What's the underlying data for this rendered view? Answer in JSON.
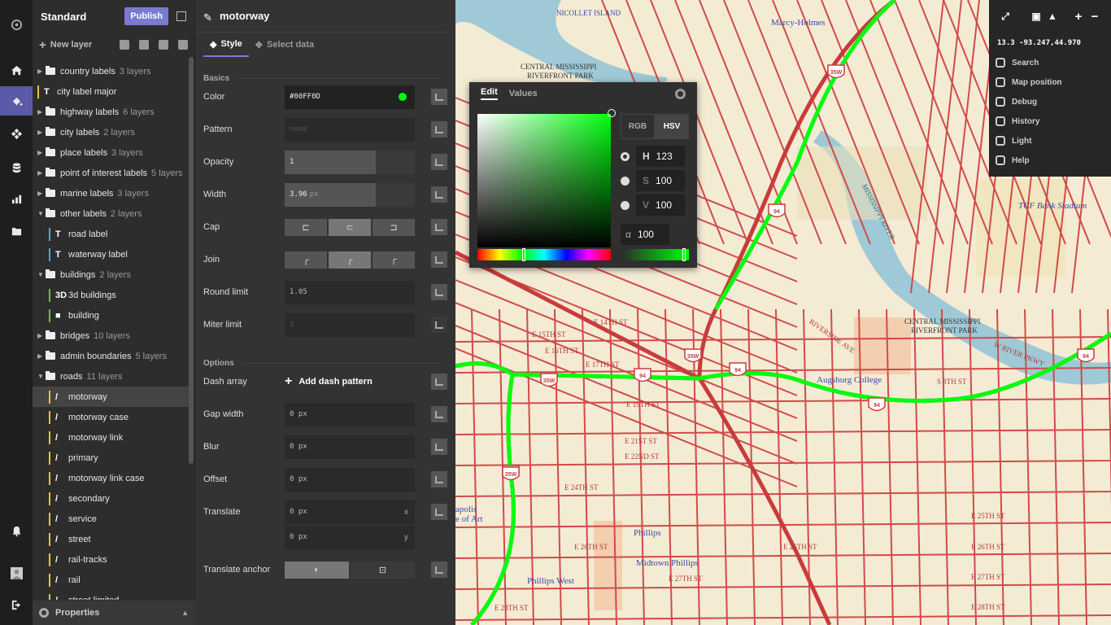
{
  "colors": {
    "accent": "#7a7ad0",
    "selected_color": "#00FF0D",
    "road_red": "#d24a4a",
    "map_bg": "#f4ebd4"
  },
  "rail": [
    {
      "icon": "logo-icon"
    },
    {
      "icon": "home-icon"
    },
    {
      "icon": "paint-bucket-icon"
    },
    {
      "icon": "components-icon"
    },
    {
      "icon": "database-icon"
    },
    {
      "icon": "chart-icon"
    },
    {
      "icon": "file-icon"
    },
    {
      "icon": "bell-icon"
    },
    {
      "icon": "user-icon"
    },
    {
      "icon": "logout-icon"
    }
  ],
  "layers_panel": {
    "title": "Standard",
    "publish": "Publish",
    "new_layer": "New layer",
    "properties": "Properties",
    "items": [
      {
        "kind": "group",
        "name": "country labels",
        "count": "3 layers",
        "open": false
      },
      {
        "kind": "layer",
        "type": "T",
        "name": "city label major",
        "bar": "#e8c23a",
        "child": false
      },
      {
        "kind": "group",
        "name": "highway labels",
        "count": "6 layers",
        "open": false
      },
      {
        "kind": "group",
        "name": "city labels",
        "count": "2 layers",
        "open": false
      },
      {
        "kind": "group",
        "name": "place labels",
        "count": "3 layers",
        "open": false
      },
      {
        "kind": "group",
        "name": "point of interest labels",
        "count": "5 layers",
        "open": false
      },
      {
        "kind": "group",
        "name": "marine labels",
        "count": "3 layers",
        "open": false
      },
      {
        "kind": "group",
        "name": "other labels",
        "count": "2 layers",
        "open": true
      },
      {
        "kind": "layer",
        "type": "T",
        "name": "road label",
        "bar": "#4aa8d8",
        "child": true
      },
      {
        "kind": "layer",
        "type": "T",
        "name": "waterway label",
        "bar": "#4aa8d8",
        "child": true
      },
      {
        "kind": "group",
        "name": "buildings",
        "count": "2 layers",
        "open": true
      },
      {
        "kind": "layer",
        "type": "3D",
        "name": "3d buildings",
        "bar": "#6ac04a",
        "child": true
      },
      {
        "kind": "layer",
        "type": "■",
        "name": "building",
        "bar": "#6ac04a",
        "child": true
      },
      {
        "kind": "group",
        "name": "bridges",
        "count": "10 layers",
        "open": false
      },
      {
        "kind": "group",
        "name": "admin boundaries",
        "count": "5 layers",
        "open": false
      },
      {
        "kind": "group",
        "name": "roads",
        "count": "11 layers",
        "open": true
      },
      {
        "kind": "layer",
        "type": "/",
        "name": "motorway",
        "bar": "#e8c23a",
        "child": true,
        "selected": true
      },
      {
        "kind": "layer",
        "type": "/",
        "name": "motorway case",
        "bar": "#e8c23a",
        "child": true
      },
      {
        "kind": "layer",
        "type": "/",
        "name": "motorway link",
        "bar": "#e8c23a",
        "child": true
      },
      {
        "kind": "layer",
        "type": "/",
        "name": "primary",
        "bar": "#e8c23a",
        "child": true
      },
      {
        "kind": "layer",
        "type": "/",
        "name": "motorway link case",
        "bar": "#e8c23a",
        "child": true
      },
      {
        "kind": "layer",
        "type": "/",
        "name": "secondary",
        "bar": "#e8c23a",
        "child": true
      },
      {
        "kind": "layer",
        "type": "/",
        "name": "service",
        "bar": "#e8c23a",
        "child": true
      },
      {
        "kind": "layer",
        "type": "/",
        "name": "street",
        "bar": "#e8c23a",
        "child": true
      },
      {
        "kind": "layer",
        "type": "/",
        "name": "rail-tracks",
        "bar": "#e8c23a",
        "child": true
      },
      {
        "kind": "layer",
        "type": "/",
        "name": "rail",
        "bar": "#e8c23a",
        "child": true
      },
      {
        "kind": "layer",
        "type": "/",
        "name": "street limited",
        "bar": "#e8c23a",
        "child": true
      }
    ]
  },
  "style_panel": {
    "layer_name": "motorway",
    "tab_style": "Style",
    "tab_select": "Select data",
    "section_basics": "Basics",
    "section_options": "Options",
    "color_label": "Color",
    "color_value": "#00FF0D",
    "pattern_label": "Pattern",
    "pattern_placeholder": "none",
    "opacity_label": "Opacity",
    "opacity_value": "1",
    "width_label": "Width",
    "width_value": "3.96",
    "width_unit": "px",
    "cap_label": "Cap",
    "join_label": "Join",
    "roundlimit_label": "Round limit",
    "roundlimit_value": "1.05",
    "miterlimit_label": "Miter limit",
    "miterlimit_value": "2",
    "dash_label": "Dash array",
    "add_dash": "Add dash pattern",
    "gap_label": "Gap width",
    "gap_value": "0 px",
    "blur_label": "Blur",
    "blur_value": "0 px",
    "offset_label": "Offset",
    "offset_value": "0 px",
    "translate_label": "Translate",
    "translate_x": "0 px",
    "translate_y": "0 px",
    "x_axis": "x",
    "y_axis": "y",
    "anchor_label": "Translate anchor"
  },
  "picker": {
    "tab_edit": "Edit",
    "tab_values": "Values",
    "rgb": "RGB",
    "hsv": "HSV",
    "h_key": "H",
    "h_val": "123",
    "s_key": "S",
    "s_val": "100",
    "v_key": "V",
    "v_val": "100",
    "a_key": "α",
    "a_val": "100"
  },
  "map_controls": {
    "coords": "13.3 -93.247,44.970",
    "items": [
      {
        "label": "Search",
        "icon": "search-icon"
      },
      {
        "label": "Map position",
        "icon": "target-icon"
      },
      {
        "label": "Debug",
        "icon": "bug-icon"
      },
      {
        "label": "History",
        "icon": "history-icon"
      },
      {
        "label": "Light",
        "icon": "sun-icon"
      },
      {
        "label": "Help",
        "icon": "help-icon"
      }
    ]
  },
  "map_labels": {
    "nicollet": "NICOLLET ISLAND",
    "marcy": "Marcy-Holmes",
    "cmrp1": "CENTRAL MISSISSIPPI",
    "cmrp1b": "RIVERFRONT PARK",
    "cmrp2": "CENTRAL MISSISSIPPI",
    "cmrp2b": "RIVERFRONT PARK",
    "tcf": "TCF Bank Stadium",
    "augsburg": "Augsburg College",
    "phillips": "Phillips",
    "midtown": "Midtown Phillips",
    "phillips_west": "Phillips West",
    "mississippi": "MISSISSIPPI RIVER",
    "apolis": "apolis",
    "ofart": "e of Art",
    "riverside": "RIVERSIDE AVE",
    "e15": "E 15TH ST",
    "e16": "E 16TH ST",
    "e17": "E 17TH ST",
    "e14": "E 14TH ST",
    "e19": "E 19TH ST",
    "e21": "E 21ST ST",
    "e22": "E 22ND ST",
    "e24": "E 24TH ST",
    "e25": "E 25TH ST",
    "e26a": "E 26TH ST",
    "e26b": "E 26TH ST",
    "e26c": "E 26TH ST",
    "e27a": "E 27TH ST",
    "e27b": "E 27TH ST",
    "e28a": "E 28TH ST",
    "e28b": "E 28TH ST",
    "s8": "S 8TH ST",
    "wriver": "W RIVER PKWY",
    "shields": [
      "35W",
      "94",
      "35W",
      "35W",
      "94",
      "94",
      "94",
      "35W",
      "35W",
      "94"
    ]
  }
}
